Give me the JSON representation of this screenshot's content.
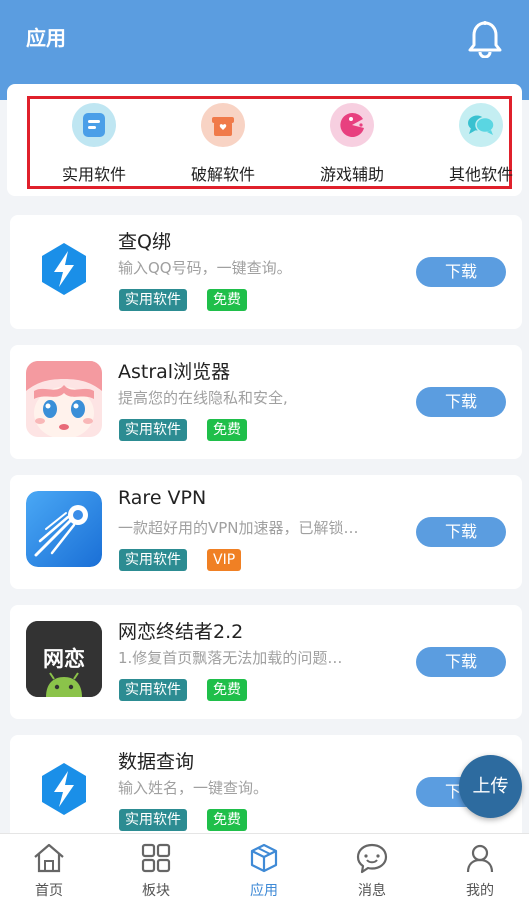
{
  "header": {
    "title": "应用",
    "bell_icon": "bell-icon"
  },
  "categories": [
    {
      "label": "实用软件",
      "icon": "document-icon",
      "bg": "#bfe6f2",
      "fg": "#4a9fe8"
    },
    {
      "label": "破解软件",
      "icon": "gift-icon",
      "bg": "#f8d3c4",
      "fg": "#f07a4a"
    },
    {
      "label": "游戏辅助",
      "icon": "pacman-icon",
      "bg": "#f7cfe0",
      "fg": "#e8407f"
    },
    {
      "label": "其他软件",
      "icon": "chat-icon",
      "bg": "#c4eef2",
      "fg": "#39c1d0"
    }
  ],
  "apps": [
    {
      "name": "查Q绑",
      "desc": "输入QQ号码，一键查询。",
      "type": "实用软件",
      "price": "免费",
      "download": "下载"
    },
    {
      "name": "Astral浏览器",
      "desc": "提高您的在线隐私和安全,",
      "type": "实用软件",
      "price": "免费",
      "download": "下载"
    },
    {
      "name": "Rare VPN",
      "desc": "一款超好用的VPN加速器，已解锁…",
      "type": "实用软件",
      "price": "VIP",
      "download": "下载"
    },
    {
      "name": "网恋终结者2.2",
      "desc": "1.修复首页飘落无法加载的问题…",
      "type": "实用软件",
      "price": "免费",
      "download": "下载",
      "icon_text": "网恋"
    },
    {
      "name": "数据查询",
      "desc": "输入姓名，一键查询。",
      "type": "实用软件",
      "price": "免费",
      "download": "下载"
    }
  ],
  "fab": {
    "label": "上传"
  },
  "tabs": [
    {
      "label": "首页",
      "icon": "home-icon"
    },
    {
      "label": "板块",
      "icon": "grid-icon"
    },
    {
      "label": "应用",
      "icon": "cube-icon",
      "active": true
    },
    {
      "label": "消息",
      "icon": "message-icon"
    },
    {
      "label": "我的",
      "icon": "user-icon"
    }
  ],
  "colors": {
    "primary": "#5b9de0",
    "highlight_border": "#e0202b",
    "tag_type": "#2c8c92",
    "tag_free": "#1fbf4a",
    "tag_vip": "#f08024"
  }
}
